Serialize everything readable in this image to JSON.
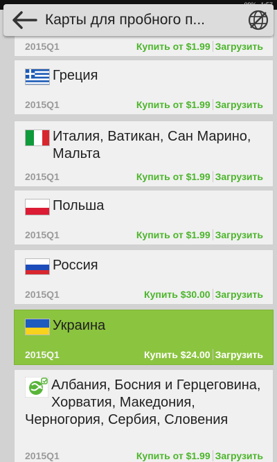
{
  "header": {
    "title": "Карты для пробного п...",
    "back_icon": "arrow-left-icon",
    "globe_icon": "globe-crossed-icon"
  },
  "status_bar": {
    "time": "1:57",
    "battery": "09%"
  },
  "colors": {
    "accent_green": "#4cb52b",
    "selected_background": "#8bc43f",
    "card_background": "#f0f0f0"
  },
  "items": [
    {
      "name": "",
      "edition": "2015Q1",
      "buy": "Купить от $1.99",
      "download": "Загрузить",
      "flag": "none"
    },
    {
      "name": "Греция",
      "edition": "2015Q1",
      "buy": "Купить от $1.99",
      "download": "Загрузить",
      "flag": "greece-flag-icon"
    },
    {
      "name": "Италия, Ватикан, Сан Марино, Мальта",
      "edition": "2015Q1",
      "buy": "Купить от $1.99",
      "download": "Загрузить",
      "flag": "italy-flag-icon"
    },
    {
      "name": "Польша",
      "edition": "2015Q1",
      "buy": "Купить от $1.99",
      "download": "Загрузить",
      "flag": "poland-flag-icon"
    },
    {
      "name": "Россия",
      "edition": "2015Q1",
      "buy": "Купить $30.00",
      "download": "Загрузить",
      "flag": "russia-flag-icon"
    },
    {
      "name": "Украина",
      "edition": "2015Q1",
      "buy": "Купить $24.00",
      "download": "Загрузить",
      "flag": "ukraine-flag-icon",
      "selected": true
    },
    {
      "name": "Албания, Босния и Герцеговина, Хорватия, Македония, Черногория, Сербия, Словения",
      "edition": "2015Q1",
      "buy": "Купить от $1.99",
      "download": "Загрузить",
      "flag": "region-globe-icon"
    }
  ]
}
